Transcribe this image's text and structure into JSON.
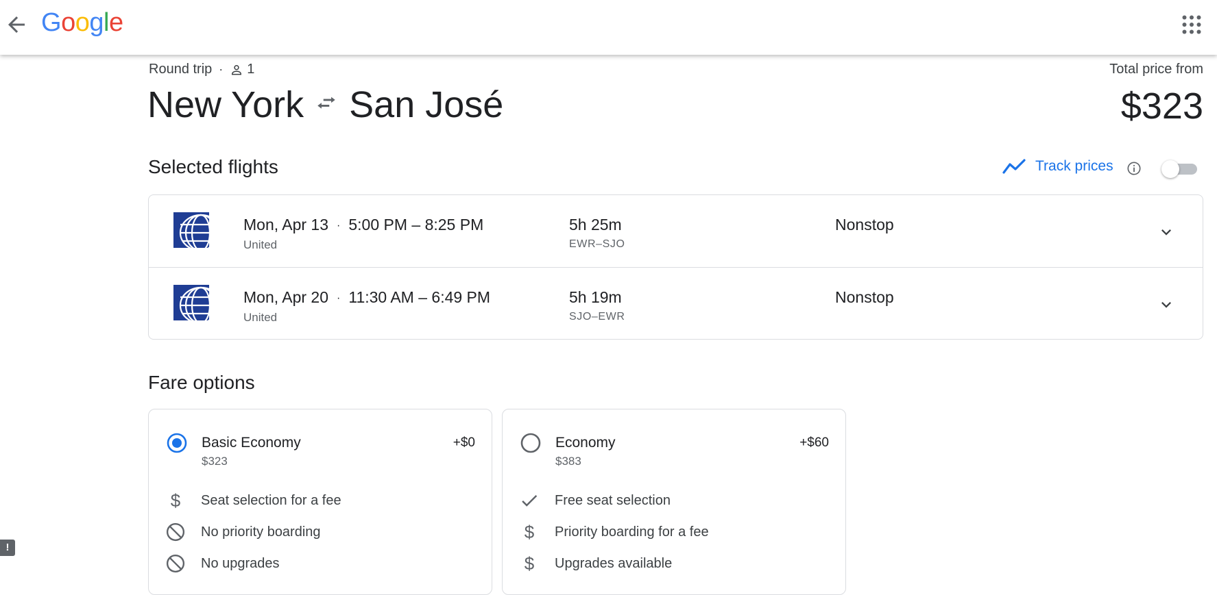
{
  "header": {
    "logo_text": "Google",
    "logo_letters": [
      "G",
      "o",
      "o",
      "g",
      "l",
      "e"
    ],
    "logo_colors": [
      "#4285F4",
      "#EA4335",
      "#FBBC05",
      "#4285F4",
      "#34A853",
      "#EA4335"
    ],
    "back_icon": "arrow-left-icon",
    "apps_icon": "apps-grid-icon"
  },
  "trip": {
    "type": "Round trip",
    "passengers": "1",
    "origin": "New York",
    "destination": "San José",
    "total_label": "Total price from",
    "total_price": "$323"
  },
  "selected_flights": {
    "title": "Selected flights",
    "track_label": "Track prices",
    "track_enabled": false,
    "flights": [
      {
        "date": "Mon, Apr 13",
        "times": "5:00 PM – 8:25 PM",
        "carrier": "United",
        "duration": "5h 25m",
        "route_codes": "EWR–SJO",
        "stops": "Nonstop"
      },
      {
        "date": "Mon, Apr 20",
        "times": "11:30 AM – 6:49 PM",
        "carrier": "United",
        "duration": "5h 19m",
        "route_codes": "SJO–EWR",
        "stops": "Nonstop"
      }
    ]
  },
  "fare_options": {
    "title": "Fare options",
    "options": [
      {
        "name": "Basic Economy",
        "price": "$323",
        "delta": "+$0",
        "selected": true,
        "features": [
          {
            "icon": "dollar-icon",
            "text": "Seat selection for a fee"
          },
          {
            "icon": "no-entry-icon",
            "text": "No priority boarding"
          },
          {
            "icon": "no-entry-icon",
            "text": "No upgrades"
          }
        ]
      },
      {
        "name": "Economy",
        "price": "$383",
        "delta": "+$60",
        "selected": false,
        "features": [
          {
            "icon": "checkmark-icon",
            "text": "Free seat selection"
          },
          {
            "icon": "dollar-icon",
            "text": "Priority boarding for a fee"
          },
          {
            "icon": "dollar-icon",
            "text": "Upgrades available"
          }
        ]
      }
    ]
  },
  "colors": {
    "accent": "#1a73e8",
    "airline_logo": "#1f3d94"
  },
  "feedback_label": "!"
}
